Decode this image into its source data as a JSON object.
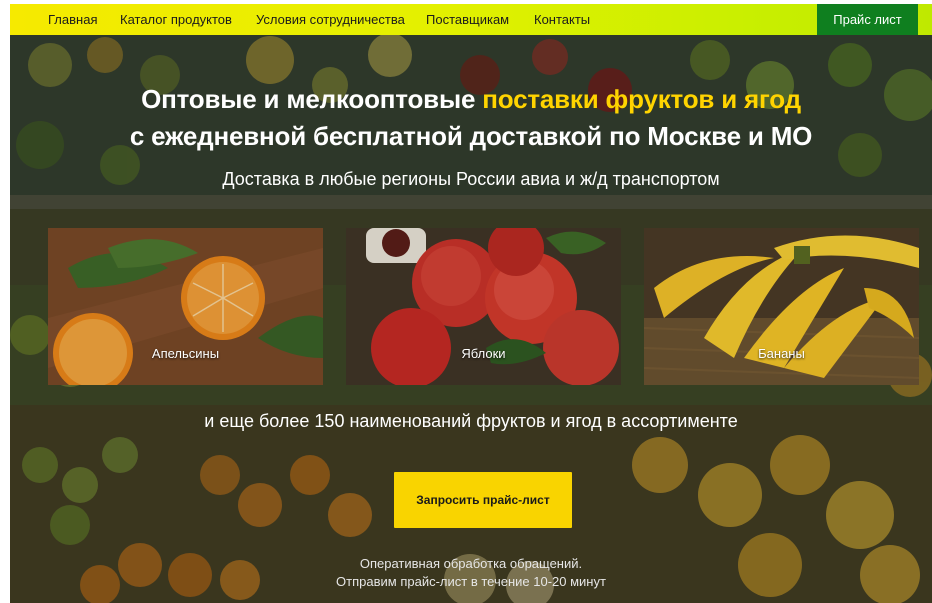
{
  "nav": {
    "items": [
      "Главная",
      "Каталог продуктов",
      "Условия сотрудничества",
      "Поставщикам",
      "Контакты"
    ],
    "price_button": "Прайс лист"
  },
  "hero": {
    "title_line1_part1": "Оптовые и мелкооптовые ",
    "title_line1_highlight": "поставки фруктов и ягод",
    "title_line2": "с ежедневной бесплатной доставкой по Москве и МО",
    "subtitle": "Доставка в любые регионы России авиа и ж/д транспортом"
  },
  "products": [
    {
      "name": "Апельсины"
    },
    {
      "name": "Яблоки"
    },
    {
      "name": "Бананы"
    }
  ],
  "assortment_text": "и еще более 150 наименований фруктов и ягод в ассортименте",
  "cta_button": "Запросить прайс-лист",
  "notes": {
    "line1": "Оперативная обработка обращений.",
    "line2": "Отправим прайс-лист в течение 10-20 минут"
  },
  "colors": {
    "nav_gradient_start": "#f6ea00",
    "nav_gradient_end": "#bfe900",
    "price_button_bg": "#0f7f1f",
    "highlight": "#ffd400",
    "cta_bg": "#f9d400"
  }
}
